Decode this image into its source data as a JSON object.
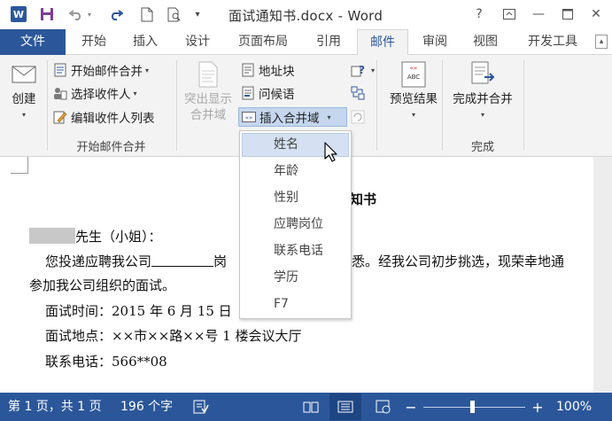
{
  "title_bar": {
    "app_logo": "W",
    "document_title": "面试通知书.docx - Word",
    "help": "?",
    "window_buttons": {
      "minimize": "—",
      "close": "✕"
    }
  },
  "tabs": [
    {
      "label": "文件"
    },
    {
      "label": "开始"
    },
    {
      "label": "插入"
    },
    {
      "label": "设计"
    },
    {
      "label": "页面布局"
    },
    {
      "label": "引用"
    },
    {
      "label": "邮件",
      "active": true
    },
    {
      "label": "审阅"
    },
    {
      "label": "视图"
    },
    {
      "label": "开发工具"
    }
  ],
  "ribbon": {
    "create": {
      "label": "创建",
      "group_label": ""
    },
    "start_merge_group": {
      "group_label": "开始邮件合并",
      "start_merge": "开始邮件合并",
      "select_recipients": "选择收件人",
      "edit_recipients": "编辑收件人列表"
    },
    "write_insert_group": {
      "highlight_fields": "突出显示\n合并域",
      "highlight_line1": "突出显示",
      "highlight_line2": "合并域",
      "address_block": "地址块",
      "greeting_line": "问候语",
      "insert_merge_field": "插入合并域"
    },
    "preview": {
      "label": "预览结果",
      "icon_text": "ABC"
    },
    "finish_group": {
      "label": "完成并合并",
      "group_label": "完成"
    }
  },
  "merge_field_menu": {
    "items": [
      "姓名",
      "年龄",
      "性别",
      "应聘岗位",
      "联系电话",
      "学历",
      "F7"
    ],
    "highlighted": "姓名"
  },
  "document": {
    "heading_suffix": "知书",
    "salutation": "先生（小姐）：",
    "para1_start": "您投递应聘我公司",
    "para1_mid": "岗",
    "para1_end": "悉。经我公司初步挑选，现荣幸地通",
    "para2": "参加我公司组织的面试。",
    "time": "面试时间：2015 年 6 月 15 日",
    "place": "面试地点：××市××路××号 1 楼会议大厅",
    "phone": "联系电话：566**08"
  },
  "status_bar": {
    "page": "第 1 页，共 1 页",
    "words": "196 个字",
    "zoom": "100%",
    "zoom_level_percent": 100
  },
  "colors": {
    "accent": "#2b579a",
    "ribbon_bg": "#f3f3f3",
    "menu_highlight": "#d5e1f2"
  }
}
